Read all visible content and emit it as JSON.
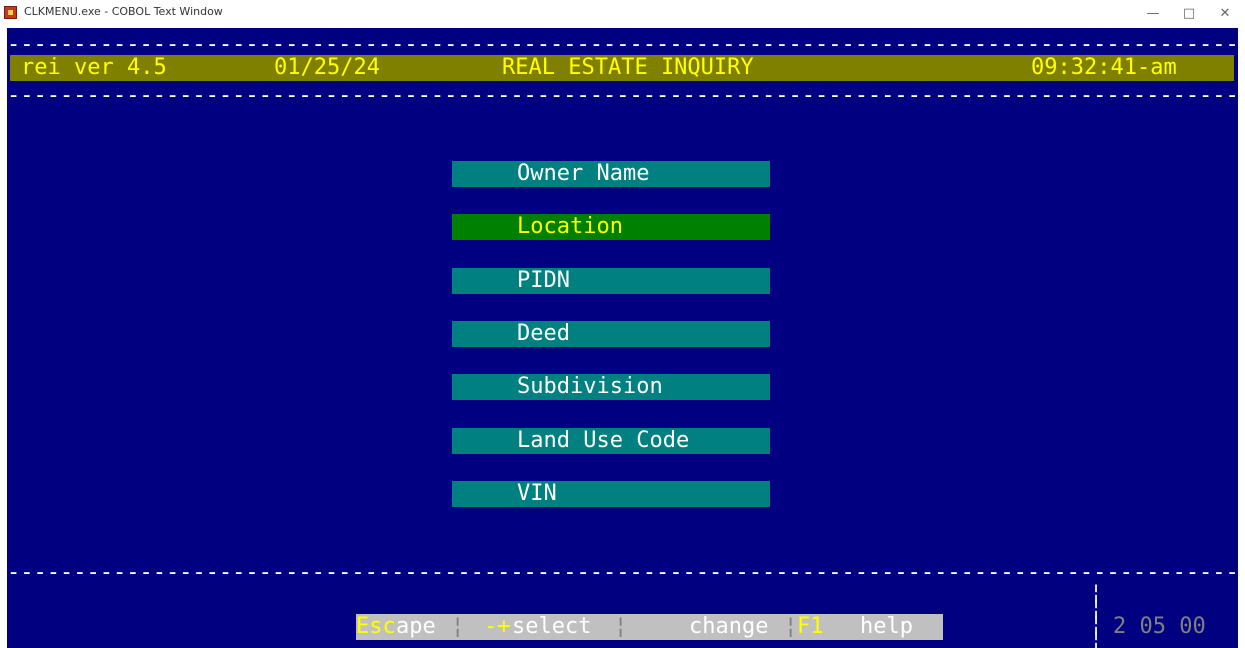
{
  "window": {
    "title": "CLKMENU.exe - COBOL Text Window",
    "minimize": "—",
    "maximize": "□",
    "close": "✕"
  },
  "header": {
    "program": "rei ver 4.5",
    "date": "01/25/24",
    "screen_title": "REAL ESTATE INQUIRY",
    "time": "09:32:41-am",
    "divider": "------------------------------------------------------------------------------------------------------------"
  },
  "menu": {
    "items": [
      {
        "label": "Owner Name"
      },
      {
        "label": "Location"
      },
      {
        "label": "PIDN"
      },
      {
        "label": "Deed"
      },
      {
        "label": "Subdivision"
      },
      {
        "label": "Land Use Code"
      },
      {
        "label": "VIN"
      }
    ],
    "selected_index": 1
  },
  "footer": {
    "esc_key": "Esc",
    "esc_label": "ape",
    "select_key": "-+",
    "select_label": "select",
    "change_label": "change",
    "f1_key": "F1",
    "f1_label": "help",
    "separator": "¦",
    "code": "2 05 00"
  },
  "colors": {
    "background": "#000080",
    "status_bar": "#808000",
    "menu_item": "#008080",
    "menu_selected": "#008000",
    "footer_bar": "#c0c0c0",
    "highlight_text": "#ffff00"
  }
}
